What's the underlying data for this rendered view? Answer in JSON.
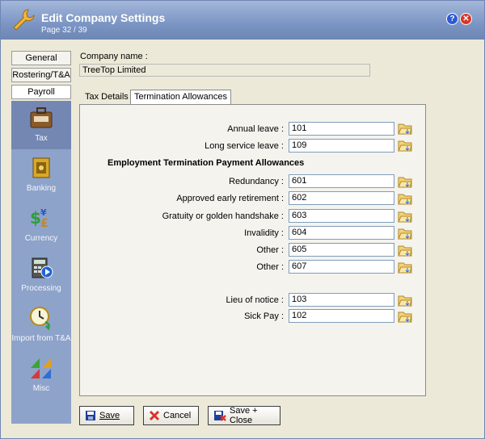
{
  "window": {
    "title": "Edit Company Settings",
    "subtitle": "Page 32 / 39",
    "help_icon": "?",
    "close_icon": "✕"
  },
  "left_tabs": [
    "General",
    "Rostering/T&A",
    "Payroll"
  ],
  "nav_items": [
    {
      "label": "Tax",
      "icon": "tax-briefcase-icon",
      "active": true
    },
    {
      "label": "Banking",
      "icon": "safe-icon",
      "active": false
    },
    {
      "label": "Currency",
      "icon": "currency-icon",
      "active": false
    },
    {
      "label": "Processing",
      "icon": "calculator-icon",
      "active": false
    },
    {
      "label": "Import from T&A",
      "icon": "clock-import-icon",
      "active": false
    },
    {
      "label": "Misc",
      "icon": "triangles-icon",
      "active": false
    }
  ],
  "company": {
    "label": "Company name :",
    "value": "TreeTop Limited"
  },
  "tabs": [
    {
      "label": "Tax Details",
      "selected": false
    },
    {
      "label": "Termination Allowances",
      "selected": true
    }
  ],
  "fields_top": [
    {
      "label": "Annual leave :",
      "value": "101"
    },
    {
      "label": "Long service leave :",
      "value": "109"
    }
  ],
  "section_title": "Employment Termination Payment Allowances",
  "fields_etp": [
    {
      "label": "Redundancy :",
      "value": "601"
    },
    {
      "label": "Approved early retirement :",
      "value": "602"
    },
    {
      "label": "Gratuity or golden handshake :",
      "value": "603"
    },
    {
      "label": "Invalidity :",
      "value": "604"
    },
    {
      "label": "Other :",
      "value": "605"
    },
    {
      "label": "Other :",
      "value": "607"
    }
  ],
  "fields_bottom": [
    {
      "label": "Lieu of notice :",
      "value": "103"
    },
    {
      "label": "Sick Pay :",
      "value": "102"
    }
  ],
  "buttons": {
    "save": "Save",
    "cancel": "Cancel",
    "save_close": "Save + Close"
  },
  "colors": {
    "title_bar": "#7b95c4",
    "nav_bg": "#8ea3c9",
    "input_border": "#7f9db9"
  }
}
